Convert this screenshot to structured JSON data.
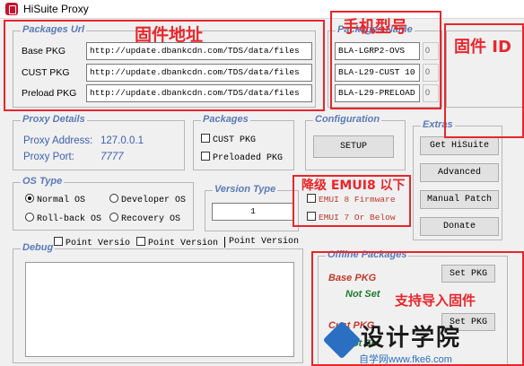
{
  "window": {
    "title": "HiSuite Proxy"
  },
  "packages_url": {
    "title": "Packages Url",
    "rows": [
      {
        "label": "Base PKG",
        "url": "http://update.dbankcdn.com/TDS/data/files"
      },
      {
        "label": "CUST PKG",
        "url": "http://update.dbankcdn.com/TDS/data/files"
      },
      {
        "label": "Preload PKG",
        "url": "http://update.dbankcdn.com/TDS/data/files"
      }
    ]
  },
  "packages_name": {
    "title": "Packages Name",
    "values": [
      "BLA-LGRP2-OVS",
      "BLA-L29-CUST 10",
      "BLA-L29-PRELOAD"
    ],
    "counters": [
      "0",
      "0",
      "0"
    ]
  },
  "proxy_details": {
    "title": "Proxy Details",
    "address_label": "Proxy Address:",
    "address_value": "127.0.0.1",
    "port_label": "Proxy Port:",
    "port_value": "7777"
  },
  "packages": {
    "title": "Packages",
    "cust": "CUST PKG",
    "preloaded": "Preloaded PKG"
  },
  "configuration": {
    "title": "Configuration",
    "setup": "SETUP"
  },
  "extras": {
    "title": "Extras",
    "buttons": [
      "Get HiSuite",
      "Advanced",
      "Manual Patch",
      "Donate"
    ]
  },
  "os_type": {
    "title": "OS Type",
    "options": [
      "Normal OS",
      "Developer OS",
      "Roll-back OS",
      "Recovery OS"
    ],
    "selected": "Normal OS"
  },
  "version_type": {
    "title": "Version Type",
    "value": "1"
  },
  "emui": {
    "option1": "EMUI 8 Firmware",
    "option2": "EMUI 7 Or Below"
  },
  "debug": {
    "title": "Debug",
    "points": [
      "Point Versio",
      "Point Version",
      "Point Version"
    ]
  },
  "offline_packages": {
    "title": "Offline Packages",
    "base_label": "Base PKG",
    "base_status": "Not Set",
    "cust_label": "Cust PKG",
    "cust_status": "Not Set",
    "set_button": "Set PKG"
  },
  "annotations": {
    "firmware_address": "固件地址",
    "phone_model": "手机型号",
    "firmware_id": "固件 ID",
    "downgrade": "降级 EMUI8 以下",
    "import_support": "支持导入固件"
  },
  "watermark": {
    "brand": "设计学院",
    "site": "自学网www.fke6.com"
  }
}
